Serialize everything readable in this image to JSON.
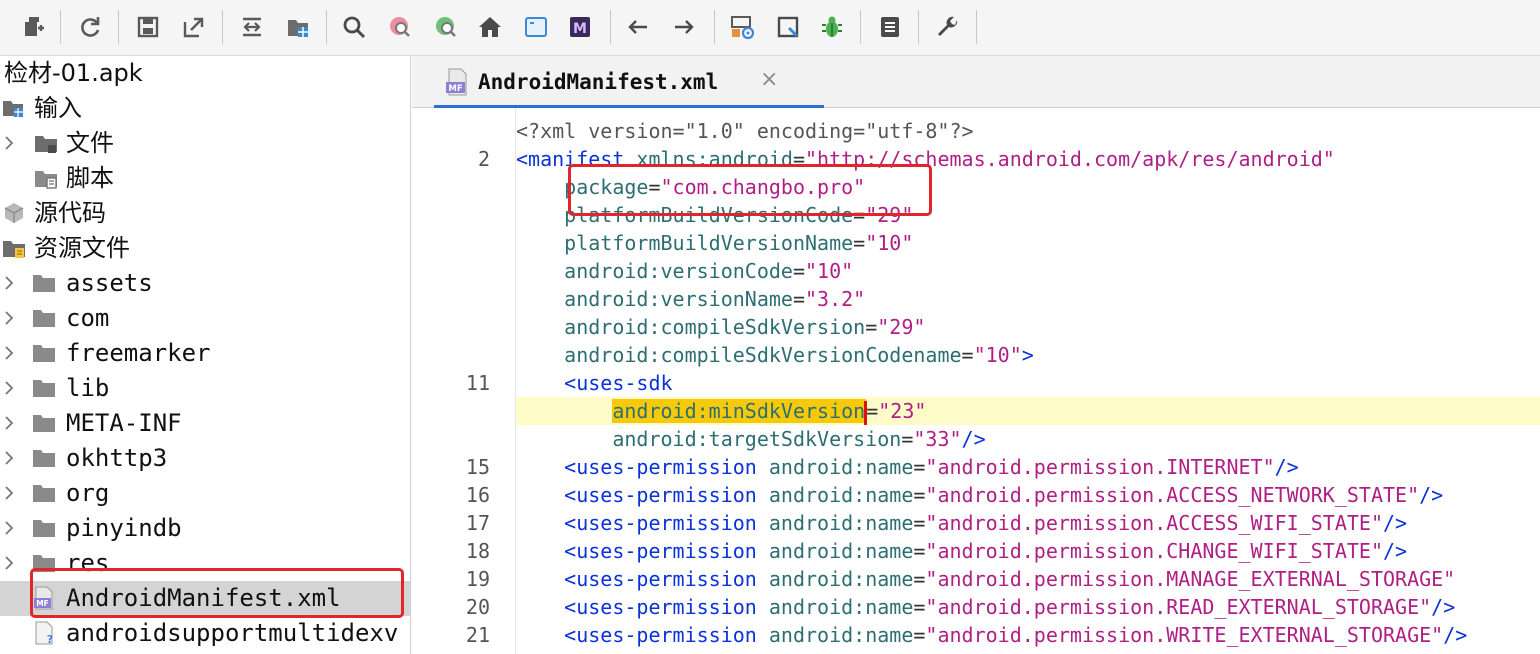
{
  "toolbar": {
    "buttons": [
      {
        "name": "open-icon"
      },
      {
        "name": "refresh-icon"
      },
      {
        "name": "save-icon"
      },
      {
        "name": "export-icon"
      },
      {
        "name": "expand-icon"
      },
      {
        "name": "resource-icon"
      },
      {
        "name": "search-icon"
      },
      {
        "name": "find-class-icon"
      },
      {
        "name": "find-usage-icon"
      },
      {
        "name": "home-icon"
      },
      {
        "name": "window-icon"
      },
      {
        "name": "manifest-m-icon"
      },
      {
        "name": "back-arrow-icon"
      },
      {
        "name": "forward-arrow-icon"
      },
      {
        "name": "decompile-settings-icon"
      },
      {
        "name": "quick-view-icon"
      },
      {
        "name": "debug-bug-icon"
      },
      {
        "name": "log-icon"
      },
      {
        "name": "preferences-wrench-icon"
      }
    ]
  },
  "tree": {
    "root": "检材-01.apk",
    "items": [
      {
        "label": "输入",
        "icon": "input-folder-icon"
      },
      {
        "label": "文件",
        "icon": "folder-icon"
      },
      {
        "label": "脚本",
        "icon": "script-folder-icon"
      },
      {
        "label": "源代码",
        "icon": "package-icon"
      },
      {
        "label": "资源文件",
        "icon": "resource-folder-icon"
      },
      {
        "label": "assets",
        "icon": "folder-icon"
      },
      {
        "label": "com",
        "icon": "folder-icon"
      },
      {
        "label": "freemarker",
        "icon": "folder-icon"
      },
      {
        "label": "lib",
        "icon": "folder-icon"
      },
      {
        "label": "META-INF",
        "icon": "folder-icon"
      },
      {
        "label": "okhttp3",
        "icon": "folder-icon"
      },
      {
        "label": "org",
        "icon": "folder-icon"
      },
      {
        "label": "pinyindb",
        "icon": "folder-icon"
      },
      {
        "label": "res",
        "icon": "folder-icon"
      },
      {
        "label": "AndroidManifest.xml",
        "icon": "manifest-file-icon"
      },
      {
        "label": "androidsupportmultidexv",
        "icon": "unknown-file-icon"
      }
    ]
  },
  "editor": {
    "tab": {
      "label": "AndroidManifest.xml",
      "close": "×",
      "icon_text": "MF"
    },
    "lines": [
      {
        "num": "",
        "parts": [
          [
            "decl",
            "<?xml version=\"1.0\" encoding=\"utf-8\"?>"
          ]
        ]
      },
      {
        "num": "2",
        "parts": [
          [
            "tag",
            "<manifest "
          ],
          [
            "attr",
            "xmlns:android"
          ],
          [
            "plain",
            "="
          ],
          [
            "val",
            "\"http://schemas.android.com/apk/res/android\""
          ]
        ]
      },
      {
        "num": "",
        "parts": [
          [
            "plain",
            "    "
          ],
          [
            "attr",
            "package"
          ],
          [
            "plain",
            "="
          ],
          [
            "val",
            "\"com.changbo.pro\""
          ]
        ]
      },
      {
        "num": "",
        "parts": [
          [
            "plain",
            "    "
          ],
          [
            "attr",
            "platformBuildVersionCode"
          ],
          [
            "plain",
            "="
          ],
          [
            "val",
            "\"29\""
          ]
        ]
      },
      {
        "num": "",
        "parts": [
          [
            "plain",
            "    "
          ],
          [
            "attr",
            "platformBuildVersionName"
          ],
          [
            "plain",
            "="
          ],
          [
            "val",
            "\"10\""
          ]
        ]
      },
      {
        "num": "",
        "parts": [
          [
            "plain",
            "    "
          ],
          [
            "attr",
            "android:versionCode"
          ],
          [
            "plain",
            "="
          ],
          [
            "val",
            "\"10\""
          ]
        ]
      },
      {
        "num": "",
        "parts": [
          [
            "plain",
            "    "
          ],
          [
            "attr",
            "android:versionName"
          ],
          [
            "plain",
            "="
          ],
          [
            "val",
            "\"3.2\""
          ]
        ]
      },
      {
        "num": "",
        "parts": [
          [
            "plain",
            "    "
          ],
          [
            "attr",
            "android:compileSdkVersion"
          ],
          [
            "plain",
            "="
          ],
          [
            "val",
            "\"29\""
          ]
        ]
      },
      {
        "num": "",
        "parts": [
          [
            "plain",
            "    "
          ],
          [
            "attr",
            "android:compileSdkVersionCodename"
          ],
          [
            "plain",
            "="
          ],
          [
            "val",
            "\"10\""
          ],
          [
            "tag",
            ">"
          ]
        ]
      },
      {
        "num": "11",
        "parts": [
          [
            "plain",
            "    "
          ],
          [
            "tag",
            "<uses-sdk"
          ]
        ]
      },
      {
        "num": "",
        "highlight": true,
        "parts": [
          [
            "plain",
            "        "
          ],
          [
            "caret1",
            "android:minSdkVersion"
          ],
          [
            "plain",
            "="
          ],
          [
            "val",
            "\"23\""
          ]
        ]
      },
      {
        "num": "",
        "parts": [
          [
            "plain",
            "        "
          ],
          [
            "attr",
            "android:targetSdkVersion"
          ],
          [
            "plain",
            "="
          ],
          [
            "val",
            "\"33\""
          ],
          [
            "tag",
            "/>"
          ]
        ]
      },
      {
        "num": "15",
        "parts": [
          [
            "plain",
            "    "
          ],
          [
            "tag",
            "<uses-permission "
          ],
          [
            "attr",
            "android:name"
          ],
          [
            "plain",
            "="
          ],
          [
            "val",
            "\"android.permission.INTERNET\""
          ],
          [
            "tag",
            "/>"
          ]
        ]
      },
      {
        "num": "16",
        "parts": [
          [
            "plain",
            "    "
          ],
          [
            "tag",
            "<uses-permission "
          ],
          [
            "attr",
            "android:name"
          ],
          [
            "plain",
            "="
          ],
          [
            "val",
            "\"android.permission.ACCESS_NETWORK_STATE\""
          ],
          [
            "tag",
            "/>"
          ]
        ]
      },
      {
        "num": "17",
        "parts": [
          [
            "plain",
            "    "
          ],
          [
            "tag",
            "<uses-permission "
          ],
          [
            "attr",
            "android:name"
          ],
          [
            "plain",
            "="
          ],
          [
            "val",
            "\"android.permission.ACCESS_WIFI_STATE\""
          ],
          [
            "tag",
            "/>"
          ]
        ]
      },
      {
        "num": "18",
        "parts": [
          [
            "plain",
            "    "
          ],
          [
            "tag",
            "<uses-permission "
          ],
          [
            "attr",
            "android:name"
          ],
          [
            "plain",
            "="
          ],
          [
            "val",
            "\"android.permission.CHANGE_WIFI_STATE\""
          ],
          [
            "tag",
            "/>"
          ]
        ]
      },
      {
        "num": "19",
        "parts": [
          [
            "plain",
            "    "
          ],
          [
            "tag",
            "<uses-permission "
          ],
          [
            "attr",
            "android:name"
          ],
          [
            "plain",
            "="
          ],
          [
            "val",
            "\"android.permission.MANAGE_EXTERNAL_STORAGE\""
          ]
        ]
      },
      {
        "num": "20",
        "parts": [
          [
            "plain",
            "    "
          ],
          [
            "tag",
            "<uses-permission "
          ],
          [
            "attr",
            "android:name"
          ],
          [
            "plain",
            "="
          ],
          [
            "val",
            "\"android.permission.READ_EXTERNAL_STORAGE\""
          ],
          [
            "tag",
            "/>"
          ]
        ]
      },
      {
        "num": "21",
        "parts": [
          [
            "plain",
            "    "
          ],
          [
            "tag",
            "<uses-permission "
          ],
          [
            "attr",
            "android:name"
          ],
          [
            "plain",
            "="
          ],
          [
            "val",
            "\"android.permission.WRITE_EXTERNAL_STORAGE\""
          ],
          [
            "tag",
            "/>"
          ]
        ]
      }
    ]
  },
  "colors": {
    "accent": "#2c6fd1",
    "annotation_box": "#e0262b",
    "line_highlight": "#fdfcc8",
    "token_highlight": "#f6c90b"
  }
}
